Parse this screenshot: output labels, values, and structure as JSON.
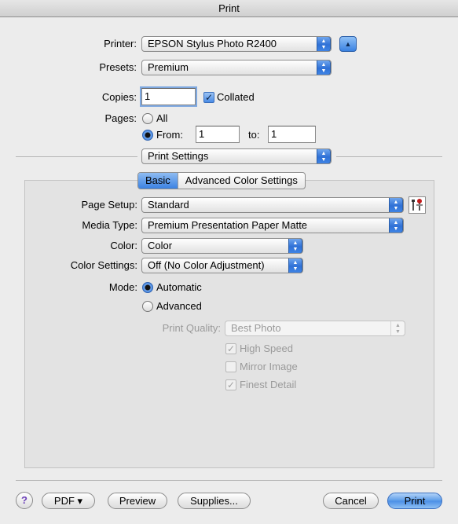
{
  "window": {
    "title": "Print"
  },
  "printer": {
    "label": "Printer:",
    "value": "EPSON Stylus Photo R2400"
  },
  "presets": {
    "label": "Presets:",
    "value": "Premium"
  },
  "copies": {
    "label": "Copies:",
    "value": "1",
    "collated_label": "Collated",
    "collated_checked": true
  },
  "pages": {
    "label": "Pages:",
    "all_label": "All",
    "from_label": "From:",
    "from_value": "1",
    "to_label": "to:",
    "to_value": "1",
    "selected": "from"
  },
  "panel_select": {
    "value": "Print Settings"
  },
  "tabs": [
    {
      "label": "Basic",
      "selected": true
    },
    {
      "label": "Advanced Color Settings",
      "selected": false
    }
  ],
  "settings": {
    "page_setup": {
      "label": "Page Setup:",
      "value": "Standard"
    },
    "media_type": {
      "label": "Media Type:",
      "value": "Premium Presentation Paper Matte"
    },
    "color": {
      "label": "Color:",
      "value": "Color"
    },
    "color_settings": {
      "label": "Color Settings:",
      "value": "Off (No Color Adjustment)"
    },
    "mode": {
      "label": "Mode:",
      "automatic_label": "Automatic",
      "advanced_label": "Advanced",
      "selected": "automatic"
    },
    "print_quality": {
      "label": "Print Quality:",
      "value": "Best Photo",
      "enabled": false
    },
    "high_speed": {
      "label": "High Speed",
      "checked": true,
      "enabled": false
    },
    "mirror_image": {
      "label": "Mirror Image",
      "checked": false,
      "enabled": false
    },
    "finest_detail": {
      "label": "Finest Detail",
      "checked": true,
      "enabled": false
    }
  },
  "footer": {
    "help_label": "?",
    "pdf_label": "PDF ▾",
    "preview_label": "Preview",
    "supplies_label": "Supplies...",
    "cancel_label": "Cancel",
    "print_label": "Print"
  },
  "icons": {
    "popup_arrows": "updown-arrows-icon",
    "collapse": "triangle-up-icon",
    "page_setup_tool": "tools-icon",
    "checkmark": "checkmark-icon"
  }
}
